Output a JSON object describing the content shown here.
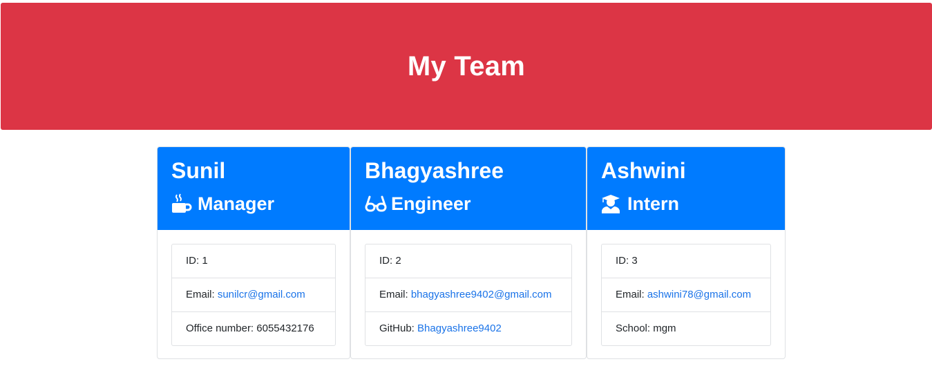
{
  "header": {
    "title": "My Team"
  },
  "team": [
    {
      "name": "Sunil",
      "role": "Manager",
      "icon": "coffee-cup-icon",
      "id_label": "ID: ",
      "id": "1",
      "email_label": "Email: ",
      "email": "sunilcr@gmail.com",
      "extra_label": "Office number: ",
      "extra_value": "6055432176"
    },
    {
      "name": "Bhagyashree",
      "role": "Engineer",
      "icon": "glasses-icon",
      "id_label": "ID: ",
      "id": "2",
      "email_label": "Email: ",
      "email": "bhagyashree9402@gmail.com",
      "extra_label": "GitHub: ",
      "extra_value": "Bhagyashree9402"
    },
    {
      "name": "Ashwini",
      "role": "Intern",
      "icon": "graduate-icon",
      "id_label": "ID: ",
      "id": "3",
      "email_label": "Email: ",
      "email": "ashwini78@gmail.com",
      "extra_label": "School: ",
      "extra_value": "mgm"
    }
  ],
  "colors": {
    "header_bg": "#dc3545",
    "card_header_bg": "#007bff",
    "link": "#1a73e8"
  }
}
